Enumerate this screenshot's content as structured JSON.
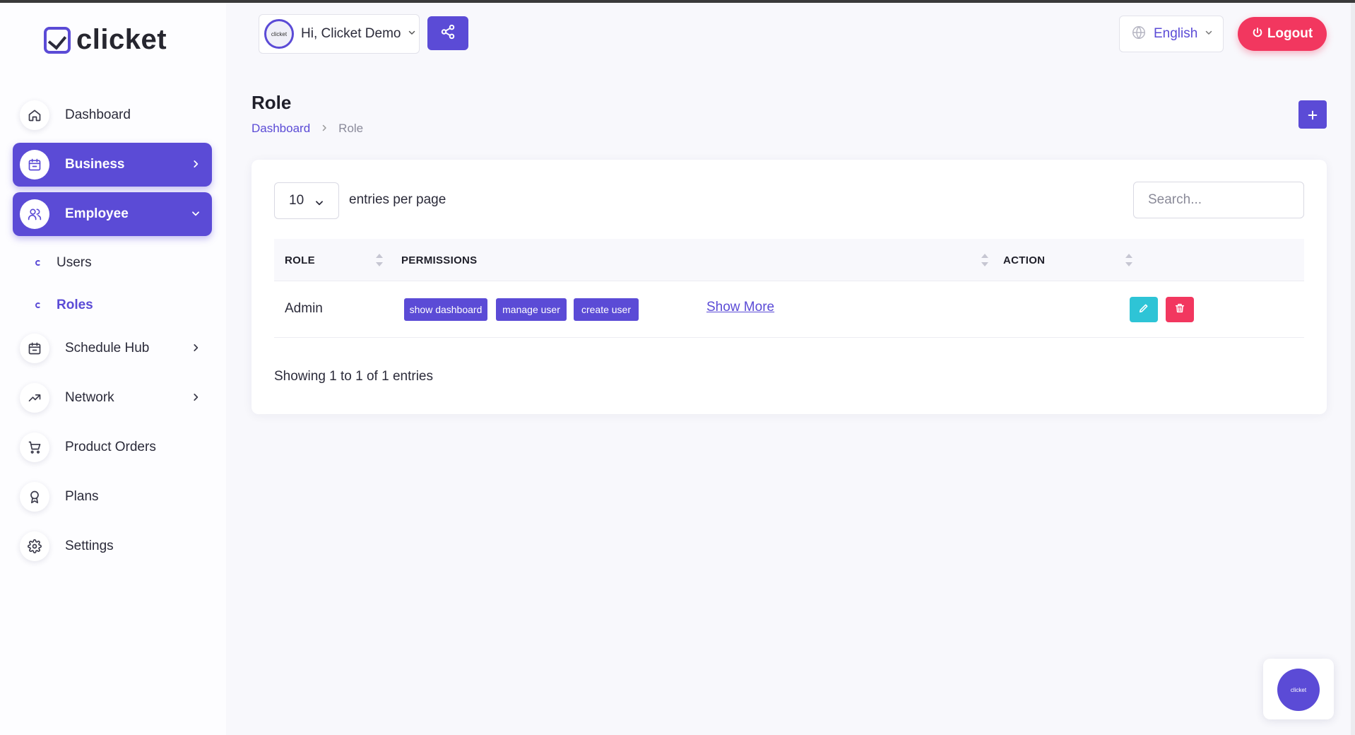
{
  "app": {
    "logo_text": "clicket"
  },
  "header": {
    "greeting": "Hi, Clicket Demo",
    "avatar_text": "clicket",
    "language": "English",
    "logout_label": "Logout"
  },
  "sidebar": {
    "items": [
      {
        "label": "Dashboard",
        "icon": "home-icon"
      },
      {
        "label": "Business",
        "icon": "calendar-icon",
        "active": true
      },
      {
        "label": "Employee",
        "icon": "users-icon",
        "active": true,
        "expanded": true
      },
      {
        "label": "Schedule Hub",
        "icon": "calendar-icon"
      },
      {
        "label": "Network",
        "icon": "trending-up-icon"
      },
      {
        "label": "Product Orders",
        "icon": "cart-icon"
      },
      {
        "label": "Plans",
        "icon": "award-icon"
      },
      {
        "label": "Settings",
        "icon": "gear-icon"
      }
    ],
    "employee_sub": [
      {
        "label": "Users"
      },
      {
        "label": "Roles",
        "active": true
      }
    ]
  },
  "page": {
    "title": "Role",
    "breadcrumb": {
      "home": "Dashboard",
      "current": "Role"
    }
  },
  "table": {
    "per_page_value": "10",
    "per_page_label": "entries per page",
    "search_placeholder": "Search...",
    "columns": [
      "ROLE",
      "PERMISSIONS",
      "ACTION"
    ],
    "rows": [
      {
        "role": "Admin",
        "permissions": [
          "show dashboard",
          "manage user",
          "create user"
        ],
        "show_more": "Show More"
      }
    ],
    "summary": "Showing 1 to 1 of 1 entries"
  },
  "float": {
    "label": "clicket"
  },
  "colors": {
    "primary": "#5b4bd6",
    "danger": "#f2375f",
    "info": "#2ec4d6"
  }
}
